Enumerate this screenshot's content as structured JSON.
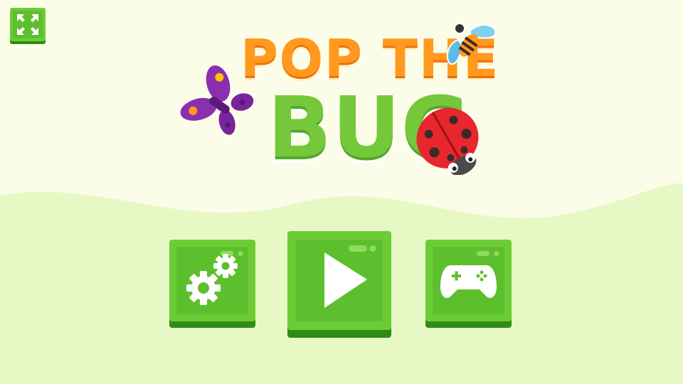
{
  "title": {
    "line1": "POP THE",
    "line2": "BUG"
  },
  "colors": {
    "background": "#fbfde8",
    "hill": "#e6f8c4",
    "button_face": "#6ccc36",
    "button_edge": "#2f8a16",
    "title_orange": "#ff9a1e",
    "title_green": "#74c83a"
  },
  "buttons": {
    "fullscreen": {
      "icon": "fullscreen-icon"
    },
    "settings": {
      "icon": "gears-icon"
    },
    "play": {
      "icon": "play-icon"
    },
    "more_games": {
      "icon": "gamepad-icon"
    }
  },
  "decorations": [
    "butterfly",
    "bee",
    "ladybug"
  ]
}
